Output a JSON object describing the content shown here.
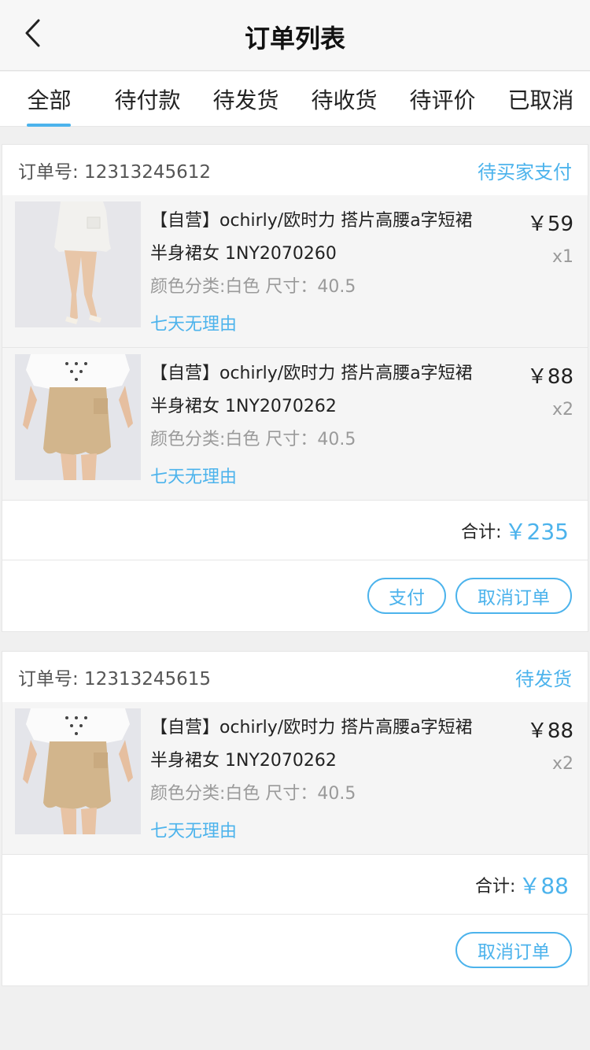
{
  "header": {
    "title": "订单列表"
  },
  "tabs": [
    {
      "label": "全部",
      "active": true
    },
    {
      "label": "待付款"
    },
    {
      "label": "待发货"
    },
    {
      "label": "待收货"
    },
    {
      "label": "待评价"
    },
    {
      "label": "已取消"
    }
  ],
  "colors": {
    "accent": "#4cb3ec",
    "text": "#222222",
    "muted": "#9a9a9a"
  },
  "orders": [
    {
      "order_no": "订单号: 12313245612",
      "status": "待买家支付",
      "items": [
        {
          "title": "【自营】ochirly/欧时力 搭片高腰a字短裙半身裙女 1NY2070260",
          "spec": "颜色分类:白色 尺寸：40.5",
          "tag": "七天无理由",
          "price": "￥59",
          "qty": "x1"
        },
        {
          "title": "【自营】ochirly/欧时力 搭片高腰a字短裙半身裙女 1NY2070262",
          "spec": "颜色分类:白色 尺寸：40.5",
          "tag": "七天无理由",
          "price": "￥88",
          "qty": "x2"
        }
      ],
      "total_label": "合计:",
      "total_value": "￥235",
      "actions": {
        "pay": "支付",
        "cancel": "取消订单"
      }
    },
    {
      "order_no": "订单号: 12313245615",
      "status": "待发货",
      "items": [
        {
          "title": "【自营】ochirly/欧时力 搭片高腰a字短裙半身裙女 1NY2070262",
          "spec": "颜色分类:白色 尺寸：40.5",
          "tag": "七天无理由",
          "price": "￥88",
          "qty": "x2"
        }
      ],
      "total_label": "合计:",
      "total_value": "￥88",
      "actions": {
        "cancel": "取消订单"
      }
    }
  ]
}
